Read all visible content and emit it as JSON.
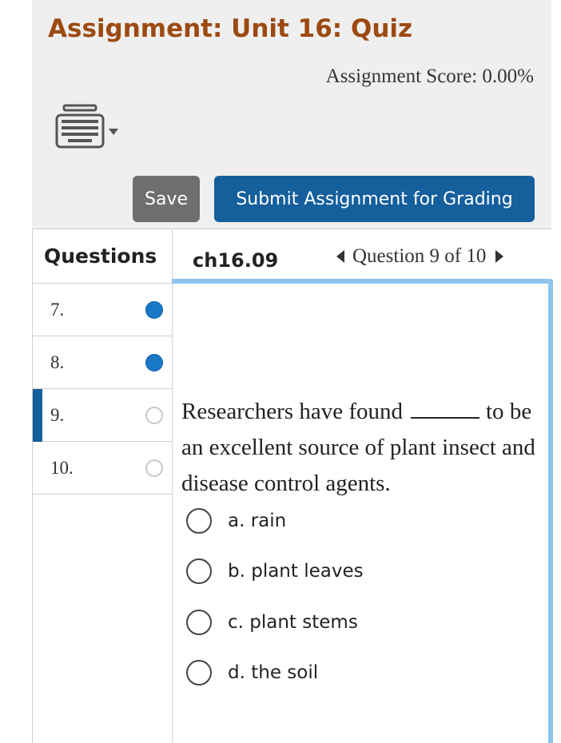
{
  "header": {
    "title": "Assignment: Unit 16: Quiz",
    "score": "Assignment Score: 0.00%"
  },
  "toolbar": {
    "keyboard_icon": "keyboard-icon",
    "save_label": "Save",
    "submit_label": "Submit Assignment for Grading"
  },
  "sidebar": {
    "heading": "Questions",
    "items": [
      {
        "label": "7.",
        "status": "answered"
      },
      {
        "label": "8.",
        "status": "answered"
      },
      {
        "label": "9.",
        "status": "unanswered",
        "current": true
      },
      {
        "label": "10.",
        "status": "unanswered"
      }
    ]
  },
  "content": {
    "tab": "ch16.09",
    "nav_text": "Question 9 of 10",
    "question_before": "Researchers have found",
    "question_mid": "to",
    "question_after": "be an excellent source of plant insect and disease control agents.",
    "choices": [
      {
        "label": "a. rain"
      },
      {
        "label": "b. plant leaves"
      },
      {
        "label": "c. plant stems"
      },
      {
        "label": "d. the soil"
      }
    ]
  },
  "colors": {
    "title": "#9c4a12",
    "primary": "#155f9c",
    "answered_dot": "#1a78c8",
    "save_button": "#6e6e6e",
    "content_border": "#8ec4ee"
  }
}
